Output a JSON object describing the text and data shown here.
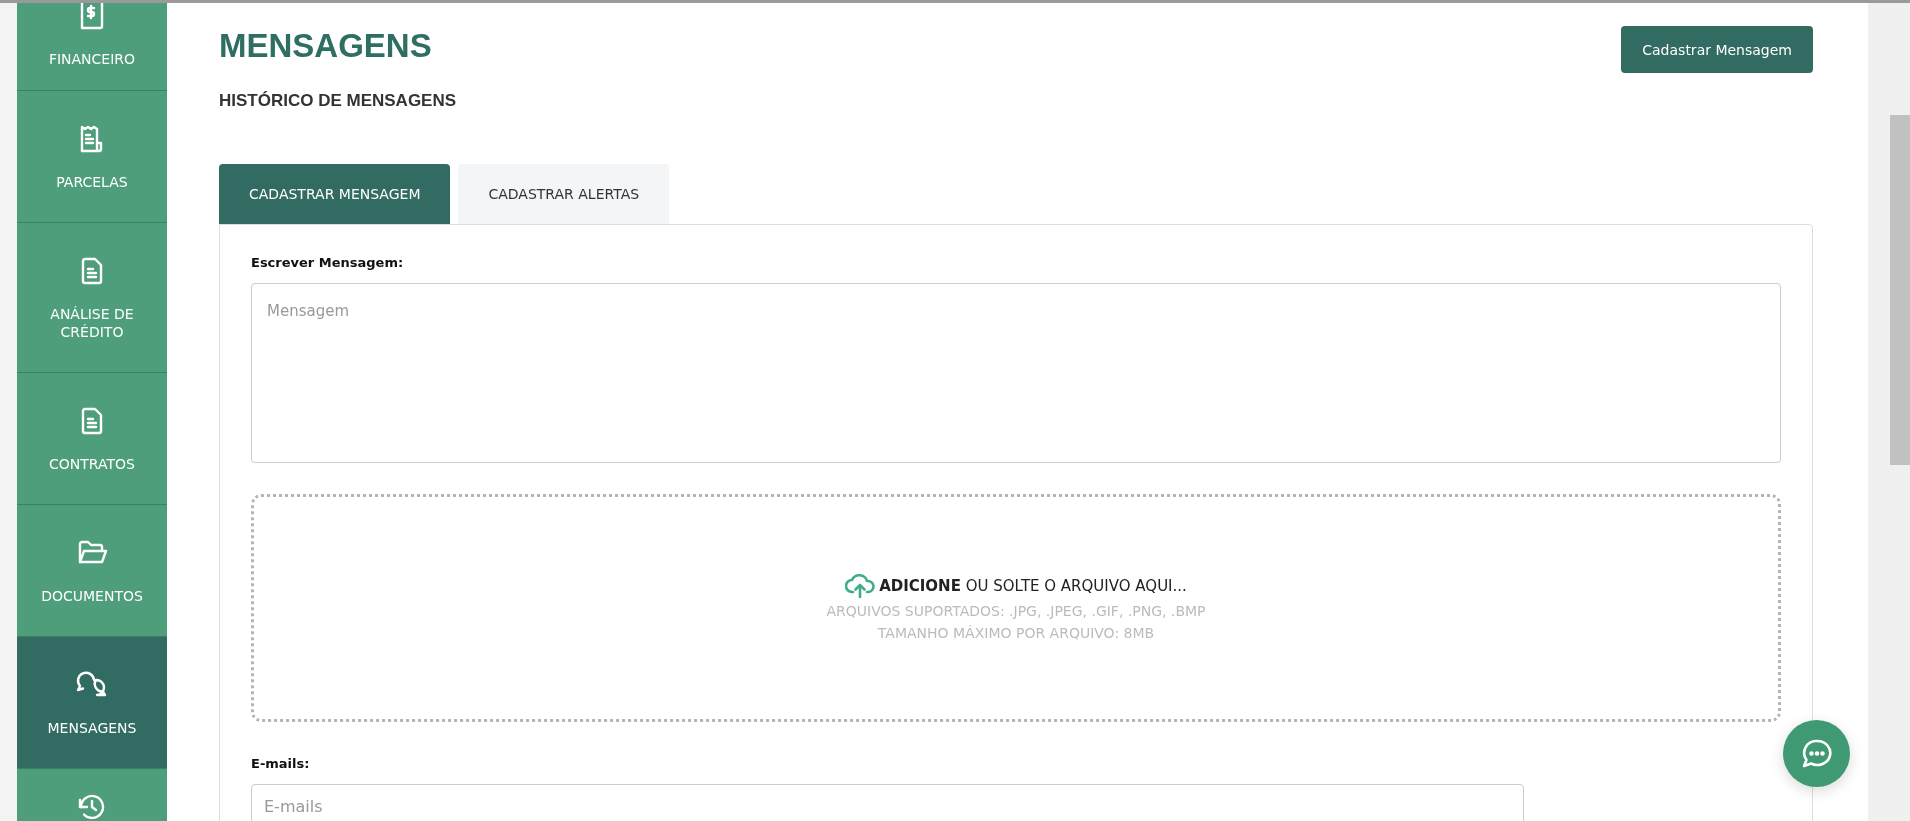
{
  "sidebar": {
    "items": [
      {
        "label": "FINANCEIRO",
        "selected": false
      },
      {
        "label": "PARCELAS",
        "selected": false
      },
      {
        "label": "ANÁLISE DE CRÉDITO",
        "selected": false
      },
      {
        "label": "CONTRATOS",
        "selected": false
      },
      {
        "label": "DOCUMENTOS",
        "selected": false
      },
      {
        "label": "MENSAGENS",
        "selected": true
      },
      {
        "selected": false
      }
    ]
  },
  "header": {
    "title": "MENSAGENS",
    "subtitle": "HISTÓRICO DE MENSAGENS",
    "button": "Cadastrar Mensagem"
  },
  "tabs": [
    {
      "label": "CADASTRAR MENSAGEM",
      "selected": true
    },
    {
      "label": "CADASTRAR ALERTAS",
      "selected": false
    }
  ],
  "form": {
    "message_label": "Escrever Mensagem:",
    "message_placeholder": "Mensagem",
    "dropzone": {
      "action": "**ADICIONE** OU SOLTE O ARQUIVO AQUI...",
      "formats": "ARQUIVOS SUPORTADOS: .JPG, .JPEG, .GIF, .PNG, .BMP",
      "max_size": "TAMANHO MÁXIMO POR ARQUIVO: 8MB"
    },
    "emails_label": "E-mails:",
    "emails_placeholder": "E-mails"
  }
}
